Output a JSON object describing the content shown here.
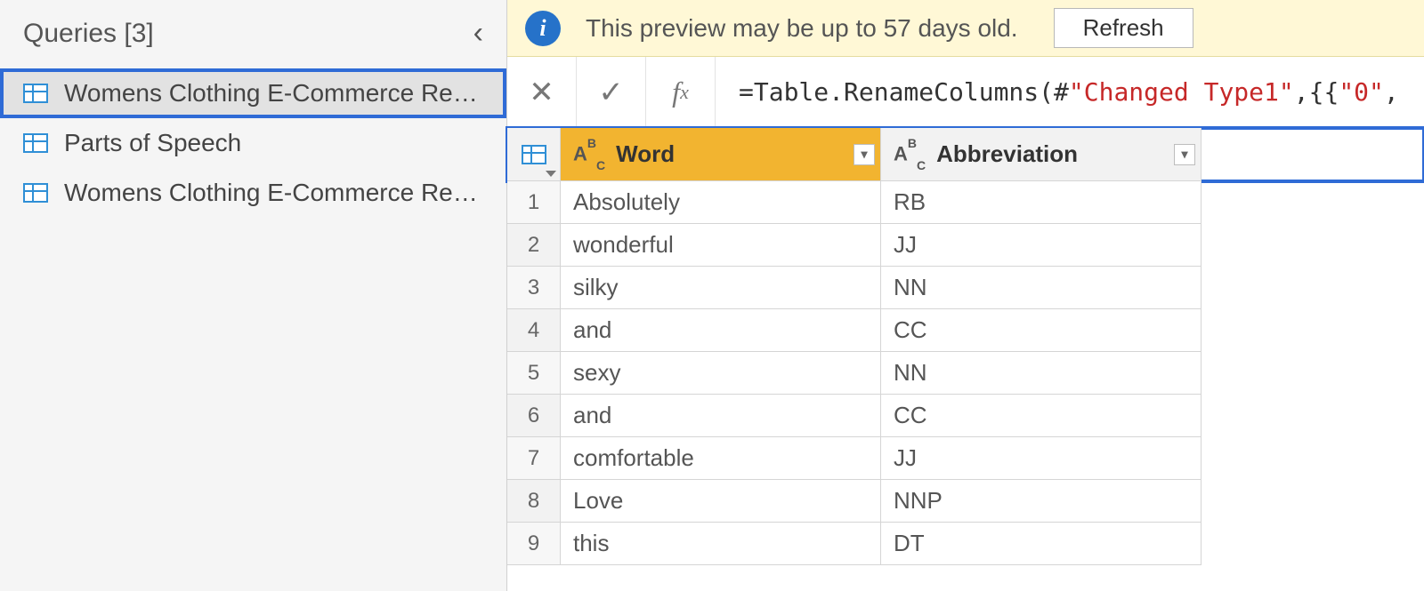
{
  "sidebar": {
    "title": "Queries [3]",
    "items": [
      {
        "label": "Womens Clothing E-Commerce Reviews",
        "selected": true
      },
      {
        "label": "Parts of Speech",
        "selected": false
      },
      {
        "label": "Womens Clothing E-Commerce Review...",
        "selected": false
      }
    ]
  },
  "warning": {
    "text": "This preview may be up to 57 days old.",
    "button": "Refresh"
  },
  "formula": {
    "prefix": "= ",
    "fn": "Table.RenameColumns",
    "open": "(#",
    "arg_str": "\"Changed Type1\"",
    "mid": ",{{",
    "arg_str2": "\"0\"",
    "tail": ", \""
  },
  "columns": [
    {
      "name": "Word",
      "selected": true
    },
    {
      "name": "Abbreviation",
      "selected": false
    }
  ],
  "rows": [
    {
      "n": "1",
      "word": "Absolutely",
      "abbr": "RB"
    },
    {
      "n": "2",
      "word": "wonderful",
      "abbr": "JJ"
    },
    {
      "n": "3",
      "word": "silky",
      "abbr": "NN"
    },
    {
      "n": "4",
      "word": "and",
      "abbr": "CC"
    },
    {
      "n": "5",
      "word": "sexy",
      "abbr": "NN"
    },
    {
      "n": "6",
      "word": "and",
      "abbr": "CC"
    },
    {
      "n": "7",
      "word": "comfortable",
      "abbr": "JJ"
    },
    {
      "n": "8",
      "word": "Love",
      "abbr": "NNP"
    },
    {
      "n": "9",
      "word": "this",
      "abbr": "DT"
    }
  ]
}
